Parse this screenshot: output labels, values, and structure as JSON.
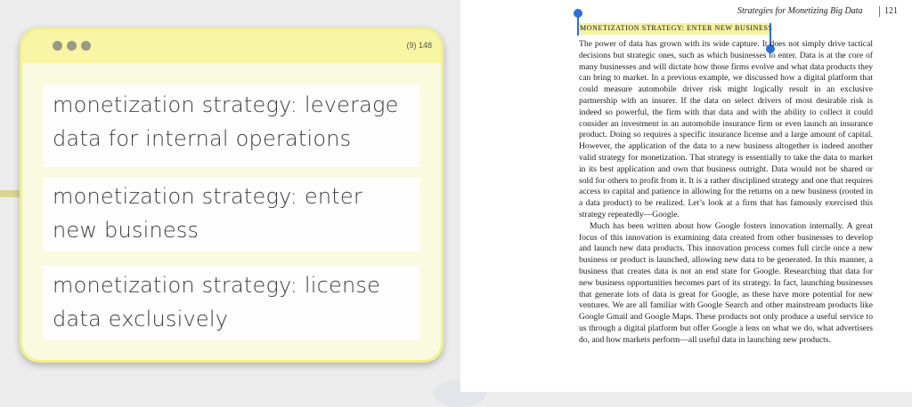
{
  "notes_card": {
    "count": "(9) 148",
    "notes": [
      "monetization strategy: leverage data for internal operations",
      "monetization strategy: enter new business",
      "monetization strategy: license data exclusively"
    ]
  },
  "book_page": {
    "running_head": "Strategies for Monetizing Big Data",
    "page_number": "121",
    "section_title": "MONETIZATION STRATEGY: ENTER NEW BUSINESS",
    "paragraphs": [
      "The power of data has grown with its wide capture. It does not simply drive tactical decisions but strategic ones, such as which businesses to enter. Data is at the core of many businesses and will dictate how those firms evolve and what data products they can bring to market. In a previous example, we discussed how a digital platform that could measure automobile driver risk might logically result in an exclusive partnership with an insurer. If the data on select drivers of most desirable risk is indeed so powerful, the firm with that data and with the ability to collect it could consider an investment in an automobile insurance firm or even launch an insurance product. Doing so requires a specific insurance license and a large amount of capital. However, the application of the data to a new business altogether is indeed another valid strategy for monetization. That strategy is essentially to take the data to market in its best application and own that business outright. Data would not be shared or sold for others to profit from it. It is a rather disciplined strategy and one that requires access to capital and patience in allowing for the returns on a new business (rooted in a data product) to be realized. Let’s look at a firm that has famously exercised this strategy repeatedly—Google.",
      "Much has been written about how Google fosters innovation internally. A great focus of this innovation is examining data created from other businesses to develop and launch new data products. This innovation process comes full circle once a new business or product is launched, allowing new data to be generated. In this manner, a business that creates data is not an end state for Google. Researching that data for new business opportunities becomes part of its strategy. In fact, launching businesses that generate lots of data is great for Google, as these have more potential for new ventures. We are all familiar with Google Search and other mainstream products like Google Gmail and Google Maps. These products not only produce a useful service to us through a digital platform but offer Google a lens on what we do, what advertisers do, and how markets perform—all useful data in launching new products."
    ]
  },
  "colors": {
    "card_background": "#fafae0",
    "card_border": "#f2ef8e",
    "highlight": "#f6f2a4",
    "selection_handle": "#2d6fd8"
  }
}
